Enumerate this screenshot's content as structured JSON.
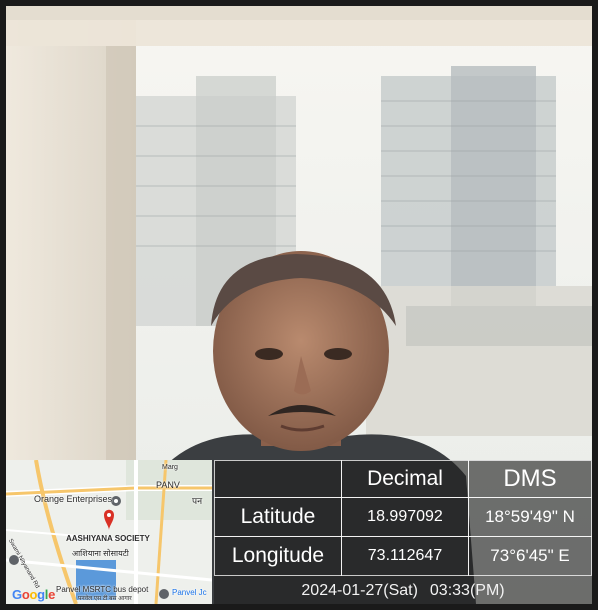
{
  "table": {
    "headers": [
      "Decimal",
      "DMS"
    ],
    "rows": [
      {
        "label": "Latitude",
        "decimal": "18.997092",
        "dms": "18°59'49\" N"
      },
      {
        "label": "Longitude",
        "decimal": "73.112647",
        "dms": "73°6'45\" E"
      }
    ]
  },
  "timestamp": {
    "date": "2024-01-27(Sat)",
    "time": "03:33(PM)"
  },
  "map": {
    "labels": {
      "orange_enterprises": "Orange Enterprises",
      "aashiyana_society": "AASHIYANA SOCIETY",
      "aashiyana_local": "आशियाना सोसायटी",
      "panvel_depot": "Panvel MSRTC bus depot",
      "panvel_depot_local": "पनवेल एस टी बस आगार",
      "panvel_j": "Panvel Jc",
      "panv": "PANV",
      "panv_local": "पन",
      "marg": "Marg",
      "swami_rd": "Swami Nityanand Rd"
    },
    "logo_letters": [
      "G",
      "o",
      "o",
      "g",
      "l",
      "e"
    ],
    "icons": [
      "map-pin-icon",
      "place-marker-icon",
      "bus-depot-icon"
    ]
  },
  "colors": {
    "table_bg": "#1e1e1e",
    "map_road": "#f6c66b",
    "map_water": "#4a8fd8",
    "pin": "#d93025"
  }
}
